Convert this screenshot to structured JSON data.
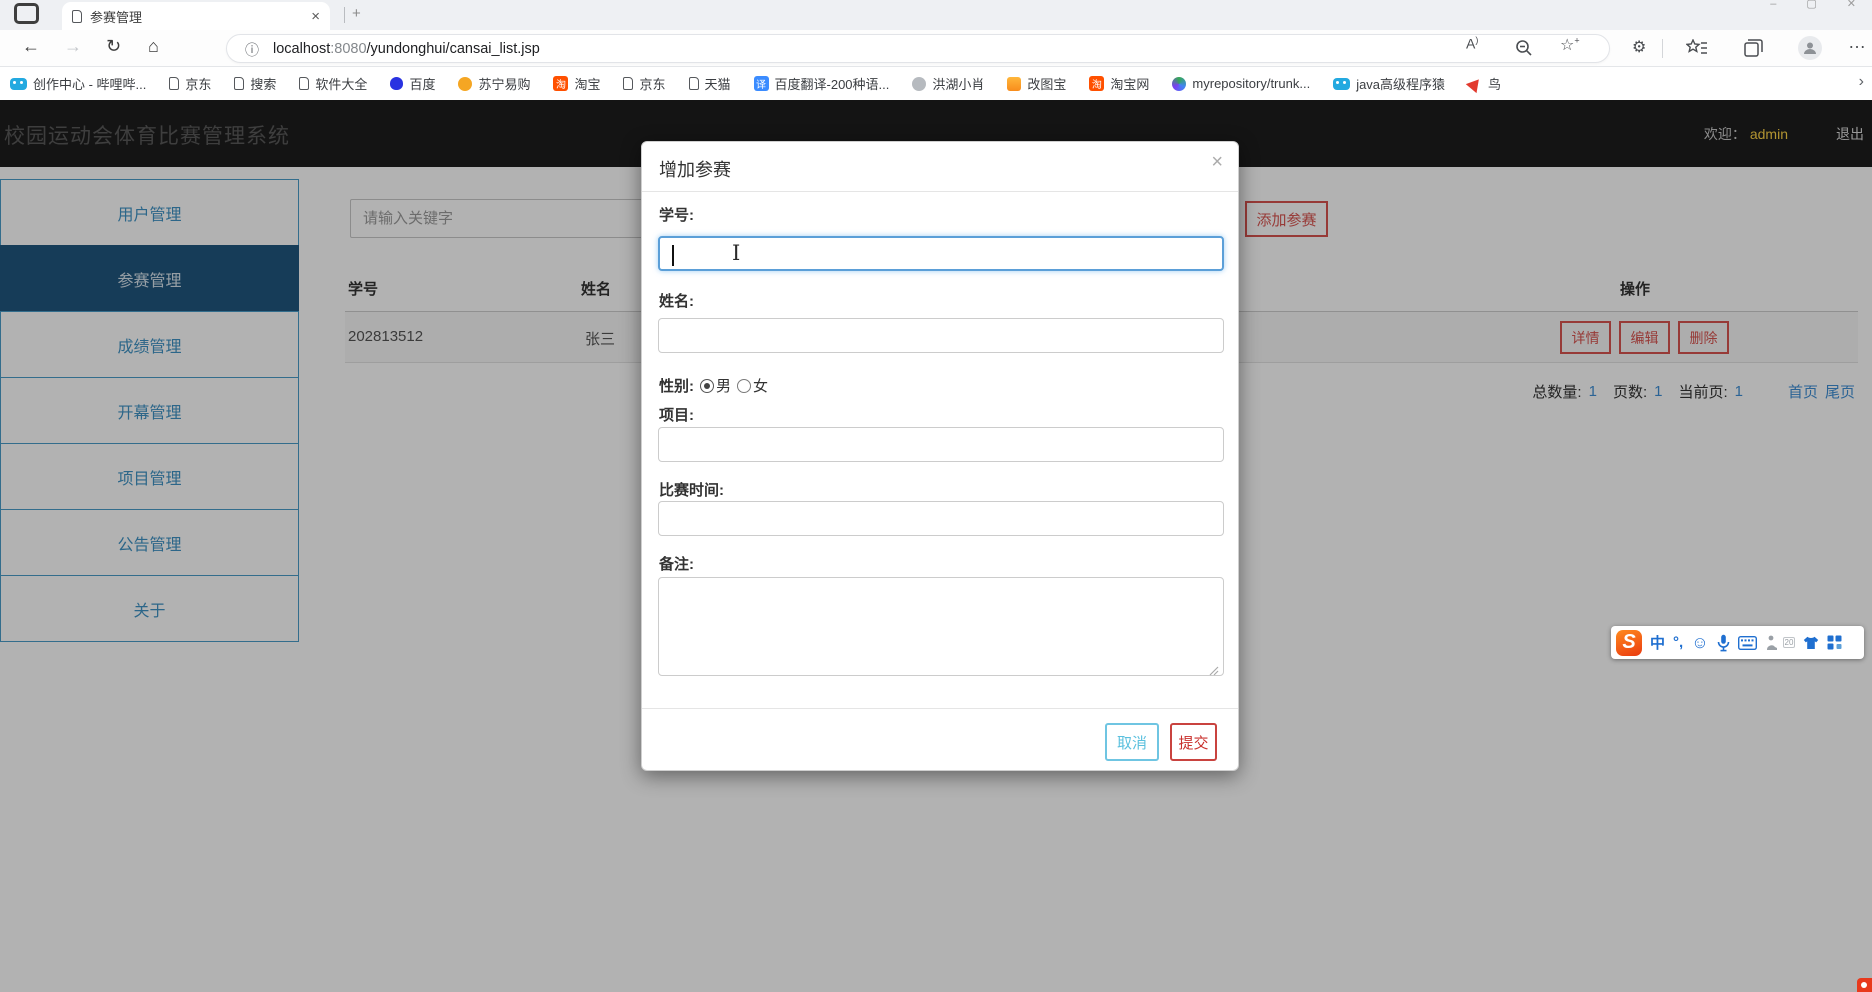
{
  "colors": {
    "accent_red": "#d9534f",
    "accent_blue": "#5bc0de",
    "link_blue": "#3e8fd6",
    "active_nav": "#20567f",
    "admin_yellow": "#ffd447",
    "header_bg": "#1e1e1e"
  },
  "browser": {
    "window_controls": {
      "minimize": "–",
      "maximize": "▢",
      "close": "✕"
    },
    "tab": {
      "title": "参赛管理",
      "close": "×",
      "new_tab": "+"
    },
    "nav": {
      "back": "←",
      "forward": "→",
      "refresh": "↻",
      "home": "⌂"
    },
    "address": {
      "info": "ⓘ",
      "host": "localhost",
      "port": ":8080",
      "path": "/yundonghui/cansai_list.jsp",
      "read_aloud": "A",
      "read_aloud_mark": ")",
      "star": "☆",
      "star_plus": "+",
      "extensions": "⚙",
      "more": "…"
    },
    "bookmarks": [
      {
        "label": "创作中心 - 哔哩哔...",
        "glyph": ""
      },
      {
        "label": "京东",
        "glyph": ""
      },
      {
        "label": "搜索",
        "glyph": ""
      },
      {
        "label": "软件大全",
        "glyph": ""
      },
      {
        "label": "百度",
        "glyph": ""
      },
      {
        "label": "苏宁易购",
        "glyph": ""
      },
      {
        "label": "淘宝",
        "glyph": "淘"
      },
      {
        "label": "京东",
        "glyph": ""
      },
      {
        "label": "天猫",
        "glyph": ""
      },
      {
        "label": "百度翻译-200种语...",
        "glyph": "译"
      },
      {
        "label": "洪湖小肖",
        "glyph": ""
      },
      {
        "label": "改图宝",
        "glyph": ""
      },
      {
        "label": "淘宝网",
        "glyph": "淘"
      },
      {
        "label": "myrepository/trunk...",
        "glyph": ""
      },
      {
        "label": "java高级程序猿",
        "glyph": ""
      },
      {
        "label": "鸟",
        "glyph": ""
      }
    ],
    "overflow_chevron": "›"
  },
  "app": {
    "header": {
      "title": "校园运动会体育比赛管理系统",
      "welcome_label": "欢迎：",
      "username": "admin",
      "logout": "退出"
    },
    "sidebar": {
      "items": [
        {
          "label": "用户管理"
        },
        {
          "label": "参赛管理"
        },
        {
          "label": "成绩管理"
        },
        {
          "label": "开幕管理"
        },
        {
          "label": "项目管理"
        },
        {
          "label": "公告管理"
        },
        {
          "label": "关于"
        }
      ]
    },
    "toolbar": {
      "search_placeholder": "请输入关键字",
      "add_button": "添加参赛"
    },
    "table": {
      "col_student_id": "学号",
      "col_name": "姓名",
      "col_actions": "操作",
      "rows": [
        {
          "student_id": "202813512",
          "name": "张三",
          "detail": "详情",
          "edit": "编辑",
          "delete": "删除"
        }
      ]
    },
    "pagination": {
      "total_label": "总数量:",
      "total": "1",
      "pages_label": "页数:",
      "pages": "1",
      "current_label": "当前页:",
      "current": "1",
      "first": "首页",
      "last": "尾页"
    }
  },
  "modal": {
    "title": "增加参赛",
    "close": "×",
    "student_id_label": "学号:",
    "name_label": "姓名:",
    "gender_label": "性别:",
    "male": "男",
    "female": "女",
    "project_label": "项目:",
    "time_label": "比赛时间:",
    "remark_label": "备注:",
    "cancel": "取消",
    "submit": "提交"
  },
  "ime": {
    "logo": "S",
    "chinese": "中",
    "punct": "°,",
    "emoji": "☺",
    "skin": "20"
  }
}
